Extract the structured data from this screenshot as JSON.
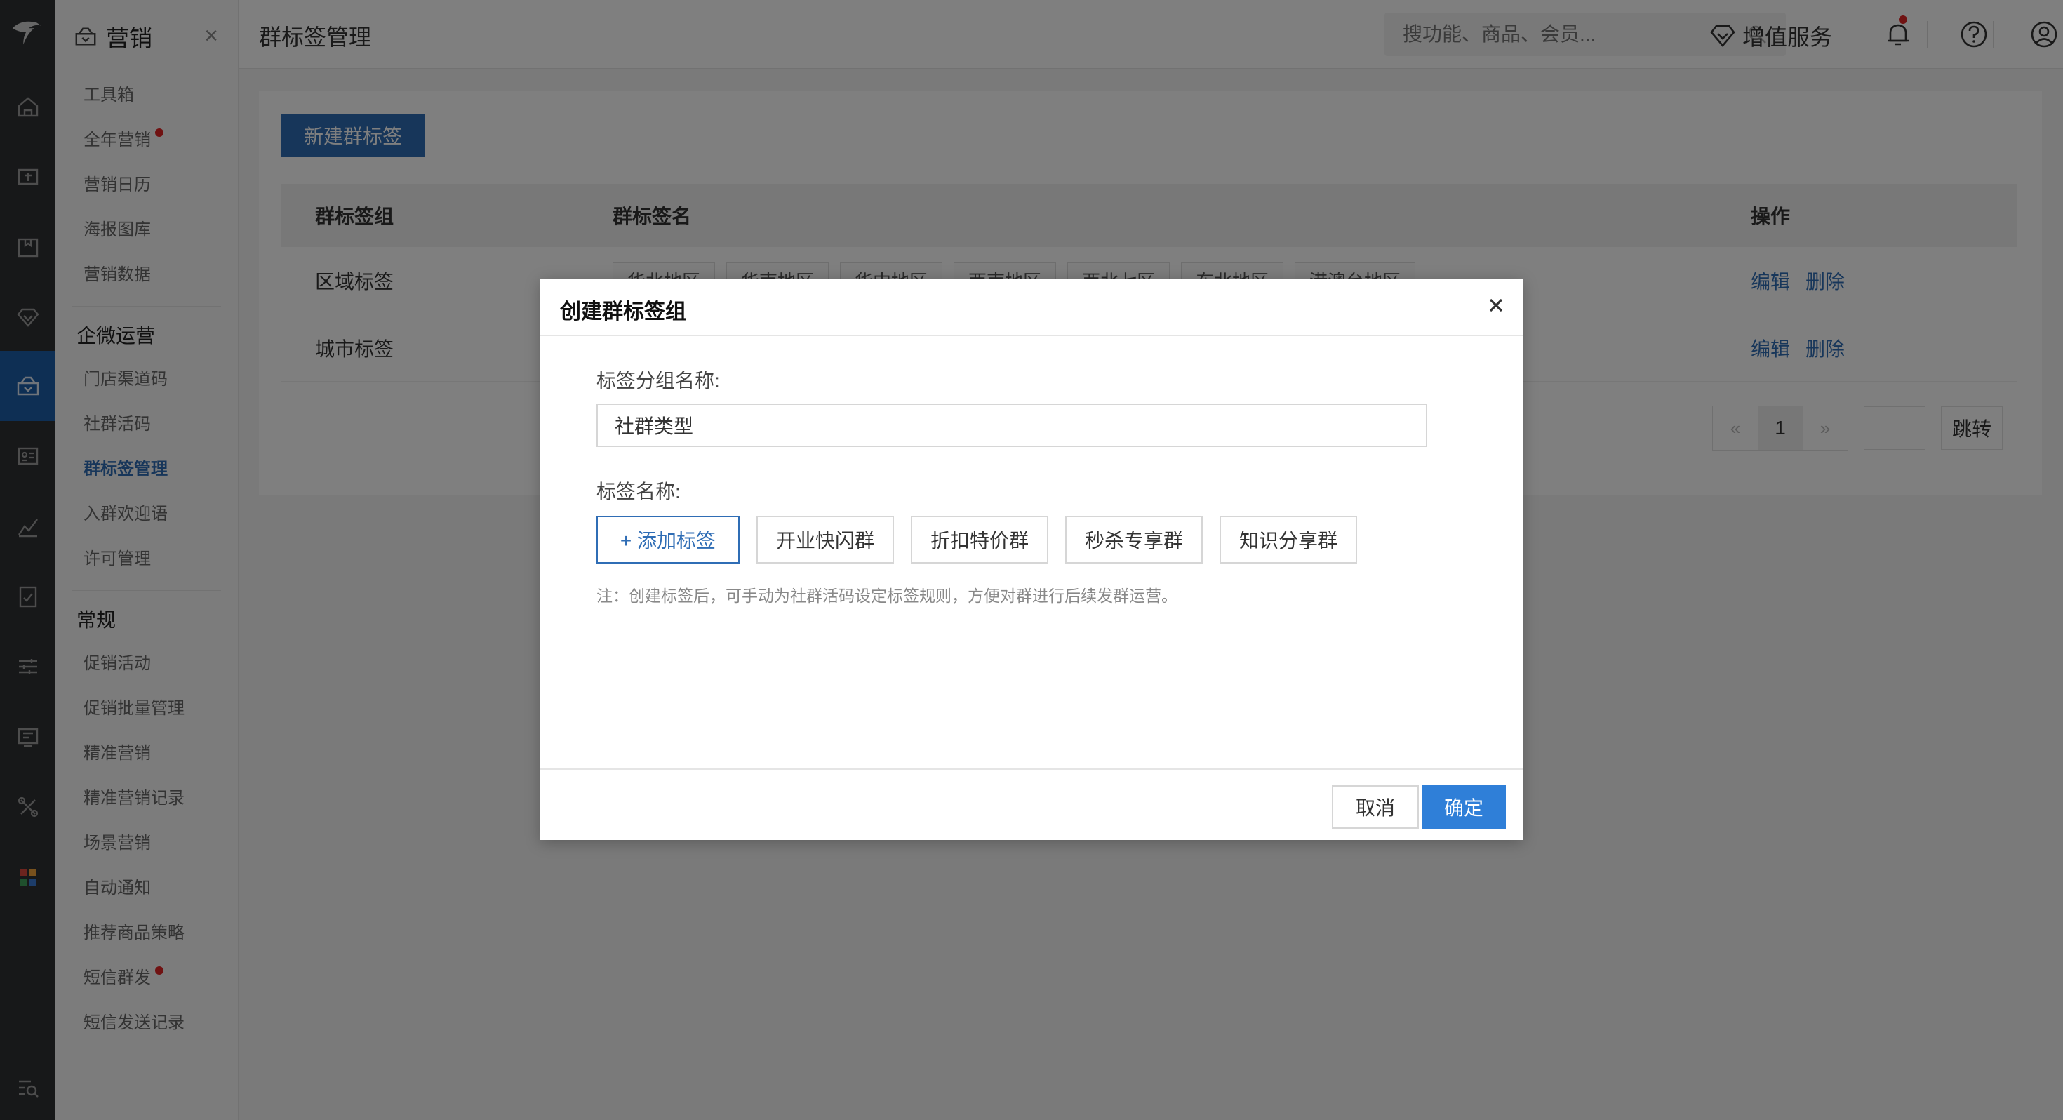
{
  "submenu": {
    "title": "营销",
    "close": "×",
    "groups": [
      {
        "title": "",
        "items": [
          {
            "label": "工具箱"
          },
          {
            "label": "全年营销",
            "dot": true
          },
          {
            "label": "营销日历"
          },
          {
            "label": "海报图库"
          },
          {
            "label": "营销数据"
          }
        ]
      },
      {
        "title": "企微运营",
        "items": [
          {
            "label": "门店渠道码"
          },
          {
            "label": "社群活码"
          },
          {
            "label": "群标签管理",
            "active": true
          },
          {
            "label": "入群欢迎语"
          },
          {
            "label": "许可管理"
          }
        ]
      },
      {
        "title": "常规",
        "items": [
          {
            "label": "促销活动"
          },
          {
            "label": "促销批量管理"
          },
          {
            "label": "精准营销"
          },
          {
            "label": "精准营销记录"
          },
          {
            "label": "场景营销"
          },
          {
            "label": "自动通知"
          },
          {
            "label": "推荐商品策略"
          },
          {
            "label": "短信群发",
            "dot": true
          },
          {
            "label": "短信发送记录"
          }
        ]
      }
    ]
  },
  "header": {
    "page_title": "群标签管理",
    "search_placeholder": "搜功能、商品、会员...",
    "value_added": "增值服务"
  },
  "main": {
    "new_button": "新建群标签",
    "columns": [
      "群标签组",
      "群标签名",
      "操作"
    ],
    "rows": [
      {
        "group": "区域标签",
        "tags": [
          "华北地区",
          "华南地区",
          "华中地区",
          "西南地区",
          "西北七区",
          "东北地区",
          "港澳台地区"
        ],
        "edit": "编辑",
        "delete": "删除"
      },
      {
        "group": "城市标签",
        "tags": [],
        "edit": "编辑",
        "delete": "删除"
      }
    ],
    "pager": {
      "prev": "«",
      "current": "1",
      "next": "»",
      "go": "跳转"
    }
  },
  "modal": {
    "title": "创建群标签组",
    "group_name_label": "标签分组名称:",
    "group_name_value": "社群类型",
    "tag_name_label": "标签名称:",
    "add_tag": "+ 添加标签",
    "tags": [
      "开业快闪群",
      "折扣特价群",
      "秒杀专享群",
      "知识分享群"
    ],
    "note": "注：创建标签后，可手动为社群活码设定标签规则，方便对群进行后续发群运营。",
    "cancel": "取消",
    "confirm": "确定"
  },
  "colors": {
    "primary": "#2f6db5",
    "confirm": "#2f7fd8",
    "rail": "#2f3033",
    "badge": "#e02424"
  }
}
